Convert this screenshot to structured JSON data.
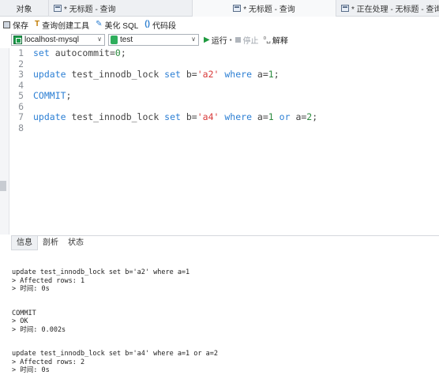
{
  "tabs": [
    {
      "label": "对象"
    },
    {
      "label": "* 无标题 - 查询"
    },
    {
      "label": "* 无标题 - 查询"
    },
    {
      "label": "* 正在处理 - 无标题 - 查询"
    }
  ],
  "toolbar": {
    "save": "保存",
    "query_builder": "查询创建工具",
    "beautify": "美化 SQL",
    "snippet": "代码段"
  },
  "connection": {
    "connection_value": "localhost-mysql",
    "database_value": "test",
    "run_label": "运行",
    "stop_label": "停止",
    "explain_label": "解释"
  },
  "editor": {
    "lines": [
      {
        "n": "1",
        "text": "set autocommit=0;"
      },
      {
        "n": "2",
        "text": ""
      },
      {
        "n": "3",
        "text": "update test_innodb_lock set b='a2' where a=1;"
      },
      {
        "n": "4",
        "text": ""
      },
      {
        "n": "5",
        "text": "COMMIT;"
      },
      {
        "n": "6",
        "text": ""
      },
      {
        "n": "7",
        "text": "update test_innodb_lock set b='a4' where a=1 or a=2;"
      },
      {
        "n": "8",
        "text": ""
      }
    ]
  },
  "result_tabs": [
    "信息",
    "剖析",
    "状态"
  ],
  "messages": [
    {
      "lines": [
        "update test_innodb_lock set b='a2' where a=1",
        "> Affected rows: 1",
        "> 时间: 0s"
      ]
    },
    {
      "lines": [
        "COMMIT",
        "> OK",
        "> 时间: 0.002s"
      ]
    },
    {
      "lines": [
        "update test_innodb_lock set b='a4' where a=1 or a=2",
        "> Affected rows: 2",
        "> 时间: 0s"
      ]
    }
  ],
  "colors": {
    "keyword": "#2c7fd4",
    "string": "#d83a3a",
    "number": "#2b8a3e",
    "run": "#1f9a3f"
  },
  "icons": [
    "table-icon",
    "save-icon",
    "query-builder-icon",
    "beautify-icon",
    "snippet-icon",
    "connection-icon",
    "database-icon",
    "play-icon",
    "stop-icon",
    "explain-icon"
  ]
}
